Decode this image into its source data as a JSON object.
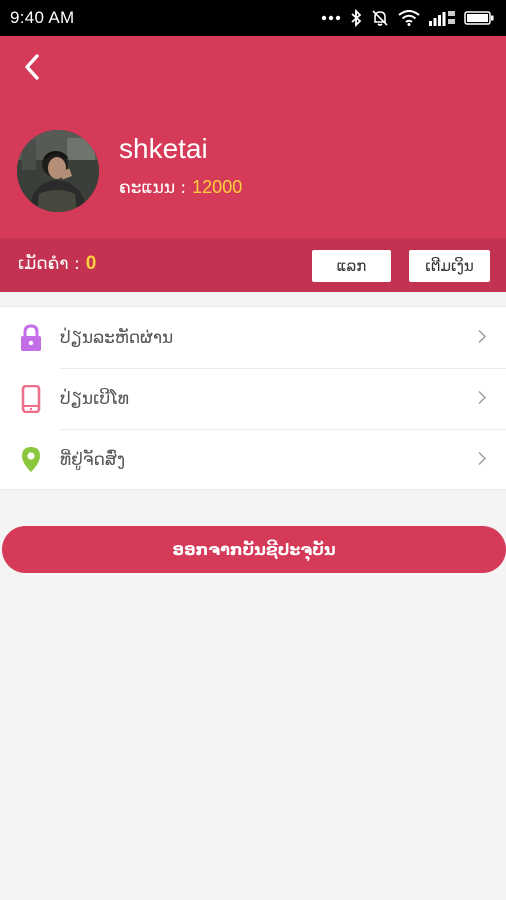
{
  "status_bar": {
    "time": "9:40 AM",
    "icons": [
      "dots-icon",
      "bluetooth-icon",
      "mute-icon",
      "wifi-icon",
      "signal-icon",
      "battery-icon"
    ]
  },
  "header": {
    "back_icon": "back-chevron-icon",
    "username": "shketai",
    "score_label": "ຄະແນນ :",
    "score_value": "12000"
  },
  "balance": {
    "label": "ເມັດຄຳ :",
    "value": "0",
    "exchange_label": "ແລກ",
    "topup_label": "ເຕີມເງິນ"
  },
  "menu": {
    "items": [
      {
        "label": "ປ່ຽນລະຫັດຜ່ານ",
        "icon": "lock-icon",
        "color": "#c36ee6"
      },
      {
        "label": "ປ່ຽນເບີໂທ",
        "icon": "phone-icon",
        "color": "#ee6f8b"
      },
      {
        "label": "ທີ່ຢູ່ຈັດສົ່ງ",
        "icon": "location-pin-icon",
        "color": "#8dc63f"
      }
    ]
  },
  "logout_label": "ອອກຈາກບັນຊີປະຈຸບັນ",
  "colors": {
    "primary": "#d63a59",
    "primary_dark": "#c43252",
    "accent_gold": "#ffcf3d"
  }
}
